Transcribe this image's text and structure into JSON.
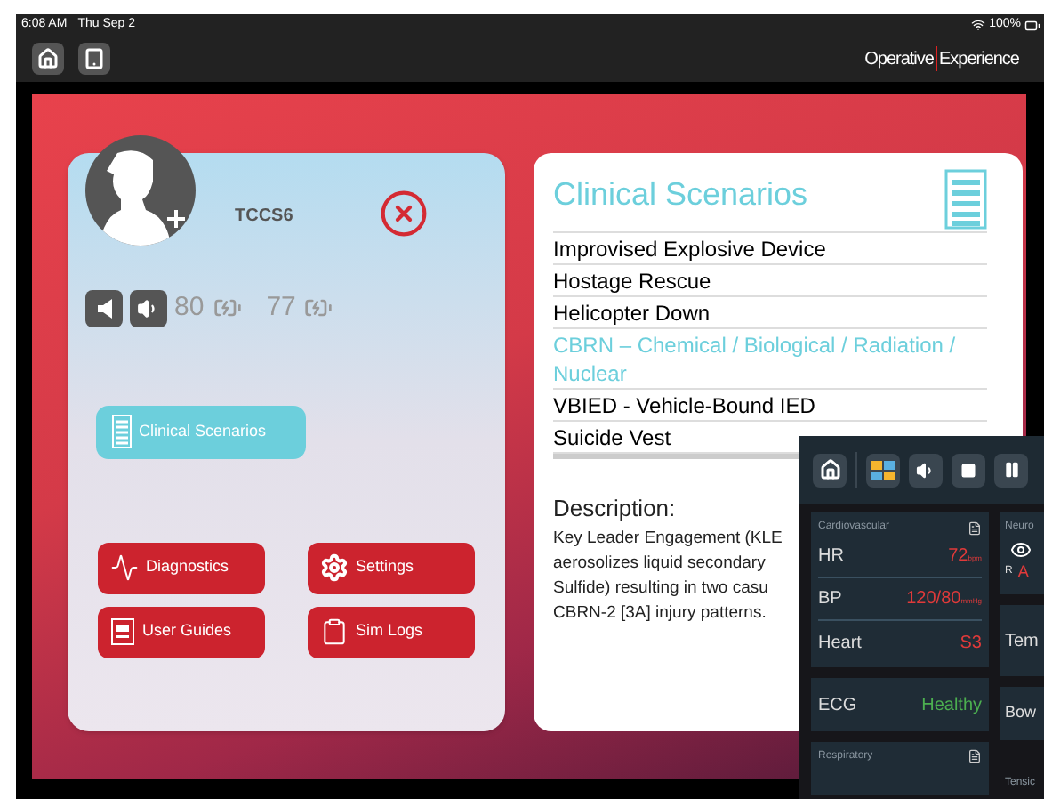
{
  "status_bar": {
    "time": "6:08 AM",
    "date": "Thu Sep 2",
    "battery": "100%"
  },
  "nav": {
    "brand_left": "Operative",
    "brand_right": "Experience"
  },
  "profile": {
    "name": "TCCS6"
  },
  "audio": {
    "readings": [
      "80",
      "77"
    ]
  },
  "menu_button": {
    "label": "Clinical Scenarios"
  },
  "actions": [
    {
      "label": "Diagnostics",
      "kind": "pulse"
    },
    {
      "label": "Settings",
      "kind": "gear"
    },
    {
      "label": "User Guides",
      "kind": "guide"
    },
    {
      "label": "Sim Logs",
      "kind": "clipboard"
    }
  ],
  "scenarios": {
    "title": "Clinical Scenarios",
    "items": [
      {
        "label": "Improvised Explosive Device",
        "selected": false
      },
      {
        "label": "Hostage Rescue",
        "selected": false
      },
      {
        "label": "Helicopter Down",
        "selected": false
      },
      {
        "label": "CBRN – Chemical / Biological / Radiation / Nuclear",
        "selected": true
      },
      {
        "label": "VBIED - Vehicle-Bound IED",
        "selected": false
      },
      {
        "label": "Suicide Vest",
        "selected": false
      }
    ],
    "description_title": "Description:",
    "description_lines": [
      "Key Leader Engagement (KLE",
      "aerosolizes liquid secondary",
      "Sulfide) resulting in two casu",
      "CBRN-2 [3A] injury patterns."
    ]
  },
  "monitor": {
    "cardiovascular": {
      "title": "Cardiovascular",
      "rows": [
        {
          "label": "HR",
          "value": "72",
          "unit": "bpm"
        },
        {
          "label": "BP",
          "value": "120/80",
          "unit": "mmHg"
        },
        {
          "label": "Heart",
          "value": "S3",
          "unit": ""
        }
      ]
    },
    "ecg": {
      "label": "ECG",
      "value": "Healthy"
    },
    "respiratory": {
      "title": "Respiratory"
    },
    "neuro": {
      "title": "Neuro",
      "side": "R",
      "value": "A"
    },
    "temp": {
      "label": "Tem"
    },
    "bowel": {
      "label": "Bow"
    },
    "tension": {
      "title": "Tensic"
    }
  }
}
